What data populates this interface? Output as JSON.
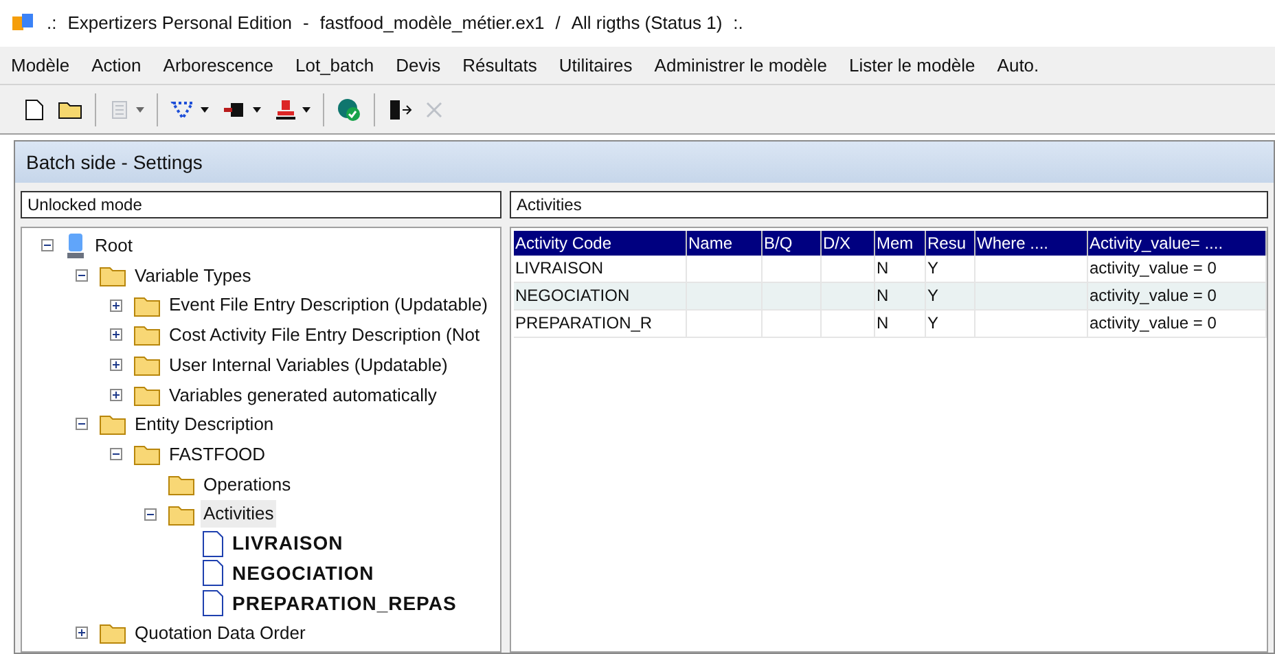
{
  "window": {
    "title_parts": [
      ".:",
      "Expertizers Personal Edition",
      "-",
      "fastfood_modèle_métier.ex1",
      "/",
      "All rigths (Status 1)",
      ":."
    ]
  },
  "menu": [
    "Modèle",
    "Action",
    "Arborescence",
    "Lot_batch",
    "Devis",
    "Résultats",
    "Utilitaires",
    "Administrer le modèle",
    "Lister le modèle",
    "Auto."
  ],
  "toolbar": [
    {
      "kind": "new",
      "disabled": false
    },
    {
      "kind": "open",
      "disabled": false
    },
    {
      "kind": "sep"
    },
    {
      "kind": "list",
      "disabled": true,
      "dropdown": true
    },
    {
      "kind": "sep"
    },
    {
      "kind": "network",
      "disabled": false,
      "dropdown": true
    },
    {
      "kind": "plug",
      "disabled": false,
      "dropdown": true
    },
    {
      "kind": "stamp",
      "disabled": false,
      "dropdown": true
    },
    {
      "kind": "sep"
    },
    {
      "kind": "database",
      "disabled": false
    },
    {
      "kind": "sep"
    },
    {
      "kind": "exit",
      "disabled": false
    },
    {
      "kind": "close",
      "disabled": true
    }
  ],
  "panel": {
    "title": "Batch side - Settings",
    "mode_field": "Unlocked mode",
    "right_field": "Activities"
  },
  "tree": [
    {
      "label": "Root",
      "kind": "root",
      "expanded": true,
      "selected": false,
      "children": [
        {
          "label": "Variable Types",
          "kind": "folder",
          "expanded": true,
          "selected": false,
          "children": [
            {
              "label": "Event File Entry Description (Updatable)",
              "kind": "folder",
              "expanded": false,
              "selected": false
            },
            {
              "label": "Cost Activity File Entry Description (Not",
              "kind": "folder",
              "expanded": false,
              "selected": false
            },
            {
              "label": "User Internal Variables (Updatable)",
              "kind": "folder",
              "expanded": false,
              "selected": false
            },
            {
              "label": "Variables generated automatically",
              "kind": "folder",
              "expanded": false,
              "selected": false
            }
          ]
        },
        {
          "label": "Entity Description",
          "kind": "folder",
          "expanded": true,
          "selected": false,
          "children": [
            {
              "label": "FASTFOOD",
              "kind": "folder",
              "expanded": true,
              "selected": false,
              "children": [
                {
                  "label": "Operations",
                  "kind": "folder",
                  "selected": false
                },
                {
                  "label": "Activities",
                  "kind": "folder",
                  "expanded": true,
                  "selected": true,
                  "children": [
                    {
                      "label": "LIVRAISON",
                      "kind": "file",
                      "selected": false
                    },
                    {
                      "label": "NEGOCIATION",
                      "kind": "file",
                      "selected": false
                    },
                    {
                      "label": "PREPARATION_REPAS",
                      "kind": "file",
                      "selected": false
                    }
                  ]
                }
              ]
            }
          ]
        },
        {
          "label": "Quotation Data Order",
          "kind": "folder",
          "expanded": false,
          "selected": false
        }
      ]
    }
  ],
  "table": {
    "columns": [
      "Activity Code",
      "Name",
      "B/Q",
      "D/X",
      "Mem",
      "Resu",
      "Where ....",
      "Activity_value= ...."
    ],
    "rows": [
      {
        "selected": false,
        "cells": [
          "LIVRAISON",
          "",
          "",
          "",
          "N",
          "Y",
          "",
          "activity_value = 0"
        ]
      },
      {
        "selected": true,
        "cells": [
          "NEGOCIATION",
          "",
          "",
          "",
          "N",
          "Y",
          "",
          "activity_value = 0"
        ]
      },
      {
        "selected": false,
        "cells": [
          "PREPARATION_R",
          "",
          "",
          "",
          "N",
          "Y",
          "",
          "activity_value = 0"
        ]
      }
    ]
  }
}
